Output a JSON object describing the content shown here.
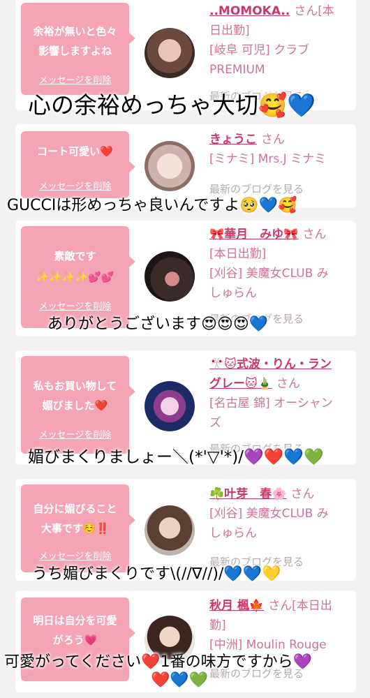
{
  "cards": [
    {
      "message": [
        "余裕が無いと色々",
        "影響しますよね"
      ],
      "delete_label": "メッセージを削除",
      "name": "..MOMOKA..",
      "san_label": "さん[本",
      "meta_lines": [
        "日出勤]",
        "[岐阜 可児] クラブ",
        "PREMIUM"
      ],
      "blog_label": "最新のブログを見る"
    },
    {
      "message": [
        "コート可愛い❤️"
      ],
      "delete_label": "メッセージを削除",
      "name": "きょうこ",
      "san_label": "さん",
      "meta_lines": [
        "[ミナミ] Mrs.J ミナミ"
      ],
      "blog_label": "最新のブログを見る"
    },
    {
      "message": [
        "素敵です",
        "✨✨✨✨💕💕"
      ],
      "delete_label": "メッセージを削除",
      "name": "🎀華月　みゆ🎀",
      "san_label": "さん",
      "meta_lines": [
        "[本日出勤]",
        "[刈谷] 美魔女CLUB み",
        "しゅらん"
      ],
      "blog_label": "最新のブログを見る"
    },
    {
      "message": [
        "私もお買い物して",
        "媚びました❤️"
      ],
      "delete_label": "メッセージを削除",
      "name_lines": [
        "🎌🐱式波・りん・ラン",
        "グレー🐱🎍"
      ],
      "san_label": "さん",
      "meta_lines": [
        "[名古屋 錦] オーシャン",
        "ズ"
      ],
      "blog_label": "最新のブログを見る"
    },
    {
      "message": [
        "自分に媚びること",
        "大事です☺️‼️"
      ],
      "delete_label": "メッセージを削除",
      "name": "☘️叶芽　春🌸",
      "san_label": "さん",
      "meta_lines": [
        "[刈谷] 美魔女CLUB み",
        "しゅらん"
      ],
      "blog_label": "最新のブログを見る"
    },
    {
      "message": [
        "明日は自分を可愛",
        "がろう💗"
      ],
      "delete_label": "メッセージを削除",
      "name": "秋月 楓🍁",
      "san_label": "さん[本日出",
      "meta_lines": [
        "勤]",
        "[中洲] Moulin Rouge"
      ],
      "blog_label": "最新のブログを見る"
    }
  ],
  "overlays": {
    "o1": "心の余裕めっちゃ大切🥰💙",
    "o2": "GUCCIは形めっちゃ良いんですよ🥺💙🥰",
    "o3": "ありがとうございます😍😍😍💙",
    "o4": "媚びまくりましょー＼(*'▽'*)/💜❤️💙💚",
    "o5": "うち媚びまくりです\\(//∇//)/💙💙💛",
    "o6a": "可愛がってください❤️1番の味方ですから💜",
    "o6b": "❤️💙💚"
  },
  "colors": {
    "bubble": "#f4a4b5",
    "name": "#c9386a",
    "meta": "#d17391",
    "background": "#f4f1f2"
  }
}
